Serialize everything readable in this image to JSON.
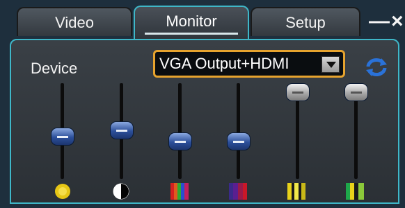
{
  "tabs": [
    {
      "label": "Video",
      "active": false
    },
    {
      "label": "Monitor",
      "active": true
    },
    {
      "label": "Setup",
      "active": false
    }
  ],
  "window_controls": {
    "text": "—×"
  },
  "device": {
    "label": "Device",
    "selected": "VGA Output+HDMI"
  },
  "sliders": [
    {
      "icon": "brightness-icon",
      "level": 0.48,
      "style": "blue"
    },
    {
      "icon": "contrast-icon",
      "level": 0.56,
      "style": "blue"
    },
    {
      "icon": "color-bars-icon",
      "level": 0.43,
      "style": "blue"
    },
    {
      "icon": "hue-bars-icon",
      "level": 0.43,
      "style": "blue"
    },
    {
      "icon": "yellow-bars-icon",
      "level": 1.0,
      "style": "grey"
    },
    {
      "icon": "green-bars-icon",
      "level": 1.0,
      "style": "grey"
    }
  ],
  "colors": {
    "panel_border": "#3fb7c8",
    "select_border": "#e6a32e",
    "refresh_icon": "#2a72d8"
  }
}
